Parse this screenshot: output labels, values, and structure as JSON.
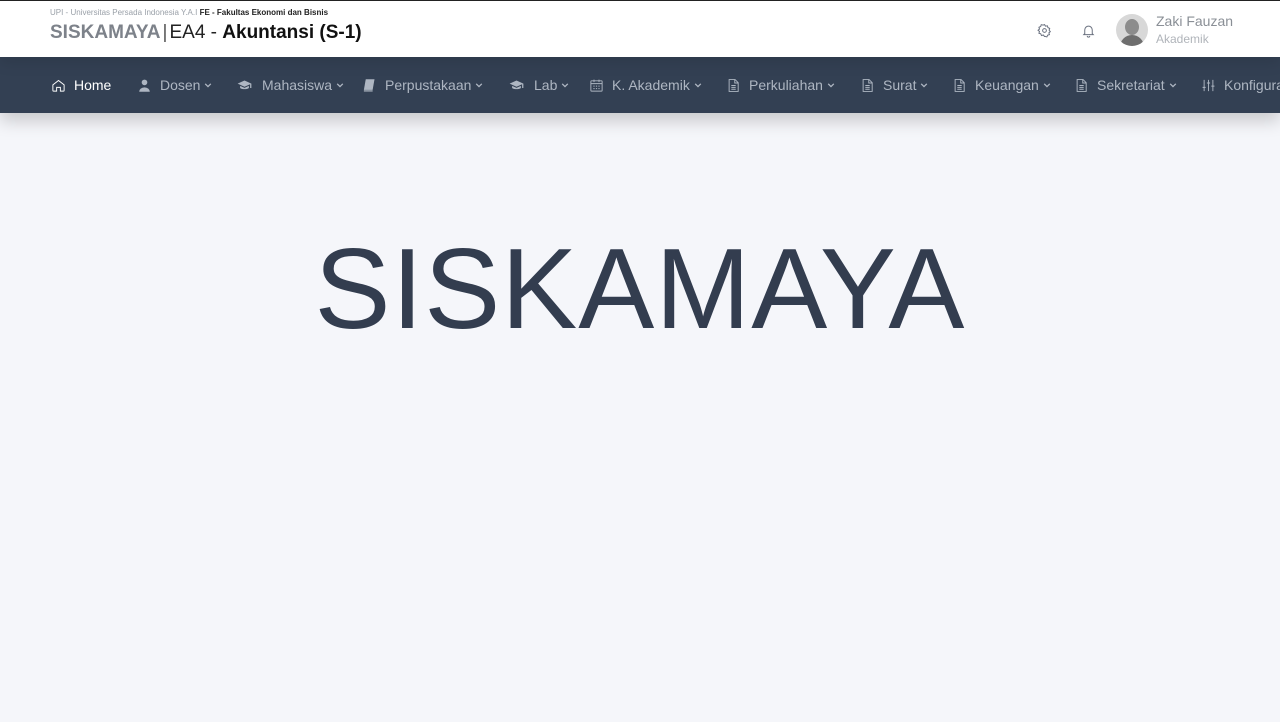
{
  "header": {
    "university": "UPI - Universitas Persada Indonesia Y.A.I",
    "faculty": "FE - Fakultas Ekonomi dan Bisnis",
    "brand": "SISKAMAYA",
    "separator": "|",
    "program_code": "EA4",
    "dash": " - ",
    "program_name": "Akuntansi (S-1)"
  },
  "user": {
    "name": "Zaki Fauzan",
    "role": "Akademik"
  },
  "nav": {
    "items": [
      {
        "label": "Home",
        "icon": "home-icon",
        "active": true
      },
      {
        "label": "Dosen",
        "icon": "user-icon"
      },
      {
        "label": "Mahasiswa",
        "icon": "graduation-cap-icon"
      },
      {
        "label": "Perpustakaan",
        "icon": "book-icon"
      },
      {
        "label": "Lab",
        "icon": "graduation-cap-icon"
      },
      {
        "label": "K. Akademik",
        "icon": "calendar-icon"
      },
      {
        "label": "Perkuliahan",
        "icon": "document-icon"
      },
      {
        "label": "Surat",
        "icon": "document-icon"
      },
      {
        "label": "Keuangan",
        "icon": "document-icon"
      },
      {
        "label": "Sekretariat",
        "icon": "document-icon"
      },
      {
        "label": "Konfigurasi",
        "icon": "sliders-icon"
      }
    ]
  },
  "main": {
    "hero_title": "SISKAMAYA"
  },
  "colors": {
    "navbar_bg": "#334053",
    "page_bg": "#f5f6fa",
    "hero_text": "#333d4f"
  }
}
